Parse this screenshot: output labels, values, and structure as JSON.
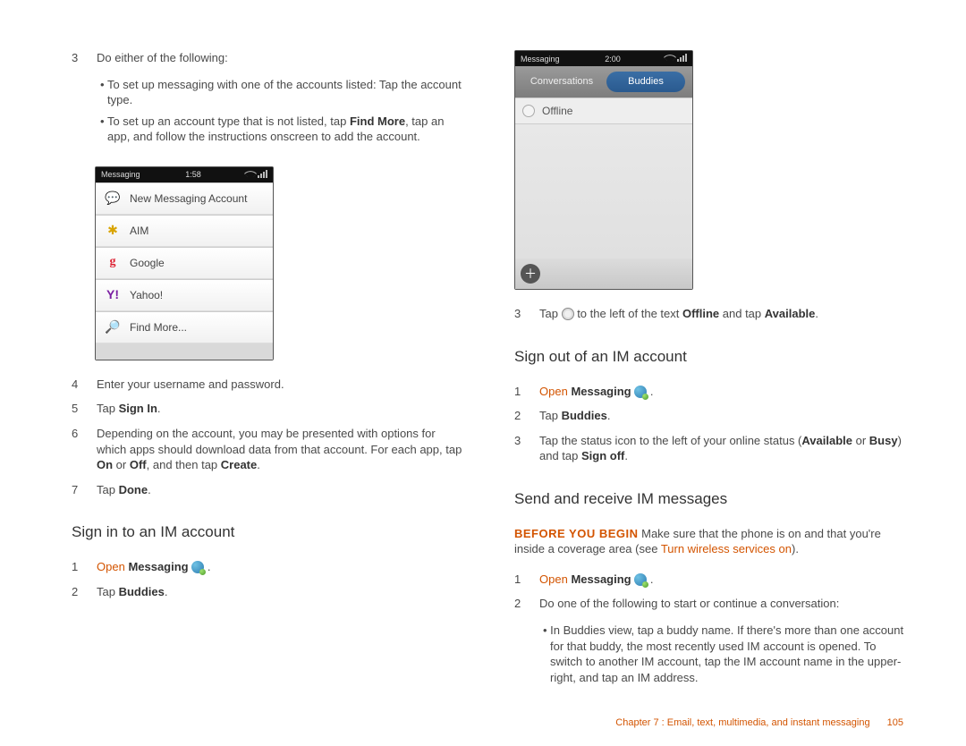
{
  "col1": {
    "s3": {
      "n": "3",
      "lead": "Do either of the following:",
      "b1a": "To set up messaging with one of the accounts listed: Tap the account type.",
      "b2a": "To set up an account type that is not listed, tap ",
      "b2bold": "Find More",
      "b2b": ", tap an app, and follow the instructions onscreen to add the account."
    },
    "phone1": {
      "status_left": "Messaging",
      "status_time": "1:58",
      "header": "New Messaging Account",
      "r1": "AIM",
      "r2": "Google",
      "r3": "Yahoo!",
      "r4": "Find More..."
    },
    "s4": {
      "n": "4",
      "t": "Enter your username and password."
    },
    "s5": {
      "n": "5",
      "t1": "Tap ",
      "b": "Sign In",
      "t2": "."
    },
    "s6": {
      "n": "6",
      "t1": "Depending on the account, you may be presented with options for which apps should download data from that account. For each app, tap ",
      "b1": "On",
      "t2": " or ",
      "b2": "Off",
      "t3": ", and then tap ",
      "b3": "Create",
      "t4": "."
    },
    "s7": {
      "n": "7",
      "t1": "Tap ",
      "b": "Done",
      "t2": "."
    },
    "h_signin": "Sign in to an IM account",
    "si1": {
      "n": "1",
      "link": "Open",
      "b": "Messaging",
      "tail": " ."
    },
    "si2": {
      "n": "2",
      "t1": "Tap ",
      "b": "Buddies",
      "t2": "."
    }
  },
  "col2": {
    "phone2": {
      "status_left": "Messaging",
      "status_time": "2:00",
      "tab1": "Conversations",
      "tab2": "Buddies",
      "offline": "Offline"
    },
    "s3": {
      "n": "3",
      "t1": "Tap ",
      "t2": " to the left of the text ",
      "b1": "Offline",
      "t3": " and tap ",
      "b2": "Available",
      "t4": "."
    },
    "h_signout": "Sign out of an IM account",
    "so1": {
      "n": "1",
      "link": "Open",
      "b": "Messaging",
      "tail": " ."
    },
    "so2": {
      "n": "2",
      "t1": "Tap ",
      "b": "Buddies",
      "t2": "."
    },
    "so3": {
      "n": "3",
      "t1": "Tap the status icon to the left of your online status (",
      "b1": "Available",
      "t2": " or ",
      "b2": "Busy",
      "t3": ") and tap ",
      "b3": "Sign off",
      "t4": "."
    },
    "h_send": "Send and receive IM messages",
    "byb": "BEFORE YOU BEGIN",
    "para1": " Make sure that the phone is on and that you're inside a coverage area (see ",
    "link_tw": "Turn wireless services on",
    "para2": ").",
    "sr1": {
      "n": "1",
      "link": "Open",
      "b": "Messaging",
      "tail": " ."
    },
    "sr2": {
      "n": "2",
      "t": "Do one of the following to start or continue a conversation:"
    },
    "sr2_bul": "In Buddies view, tap a buddy name. If there's more than one account for that buddy, the most recently used IM account is opened. To switch to another IM account, tap the IM account name in the upper-right, and tap an IM address."
  },
  "footer": {
    "chapter": "Chapter 7 : Email, text, multimedia, and instant messaging",
    "page": "105"
  }
}
